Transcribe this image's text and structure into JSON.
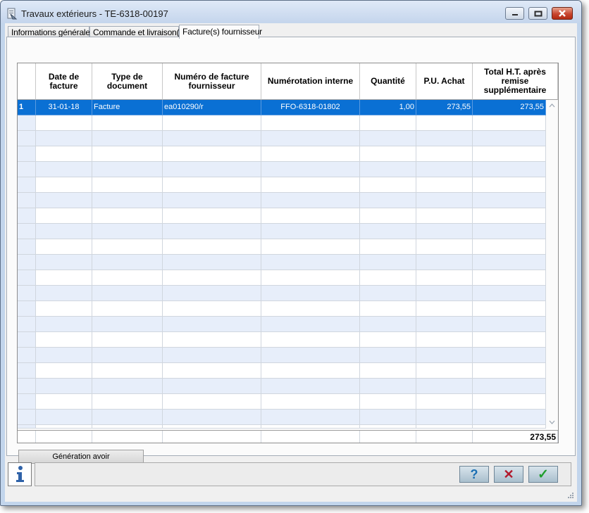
{
  "window": {
    "title": "Travaux extérieurs - TE-6318-00197",
    "controls": [
      "minimize-icon",
      "maximize-icon",
      "close-icon"
    ]
  },
  "tabs": [
    {
      "label": "Informations générales"
    },
    {
      "label": "Commande et livraison(s)"
    },
    {
      "label": "Facture(s) fournisseur",
      "active": true
    }
  ],
  "grid": {
    "columns": [
      {
        "label": ""
      },
      {
        "label": "Date de facture"
      },
      {
        "label": "Type de document"
      },
      {
        "label": "Numéro de facture fournisseur"
      },
      {
        "label": "Numérotation interne"
      },
      {
        "label": "Quantité"
      },
      {
        "label": "P.U. Achat"
      },
      {
        "label": "Total H.T. après remise supplémentaire"
      }
    ],
    "rows": [
      {
        "index": "1",
        "date": "31-01-18",
        "type": "Facture",
        "numero_fournisseur": "ea010290/r",
        "numero_interne": "FFO-6318-01802",
        "quantite": "1,00",
        "pu_achat": "273,55",
        "total_ht": "273,55"
      }
    ],
    "total": "273,55"
  },
  "buttons": {
    "generation_avoir": "Génération avoir",
    "help": "?",
    "cancel": "✕",
    "ok": "✓"
  },
  "colors": {
    "selected_row": "#0a70d4",
    "alt_row": "#e7eefa",
    "help_icon": "#1b6fb3",
    "cancel_icon": "#b2182b",
    "ok_icon": "#1f9e2c"
  }
}
